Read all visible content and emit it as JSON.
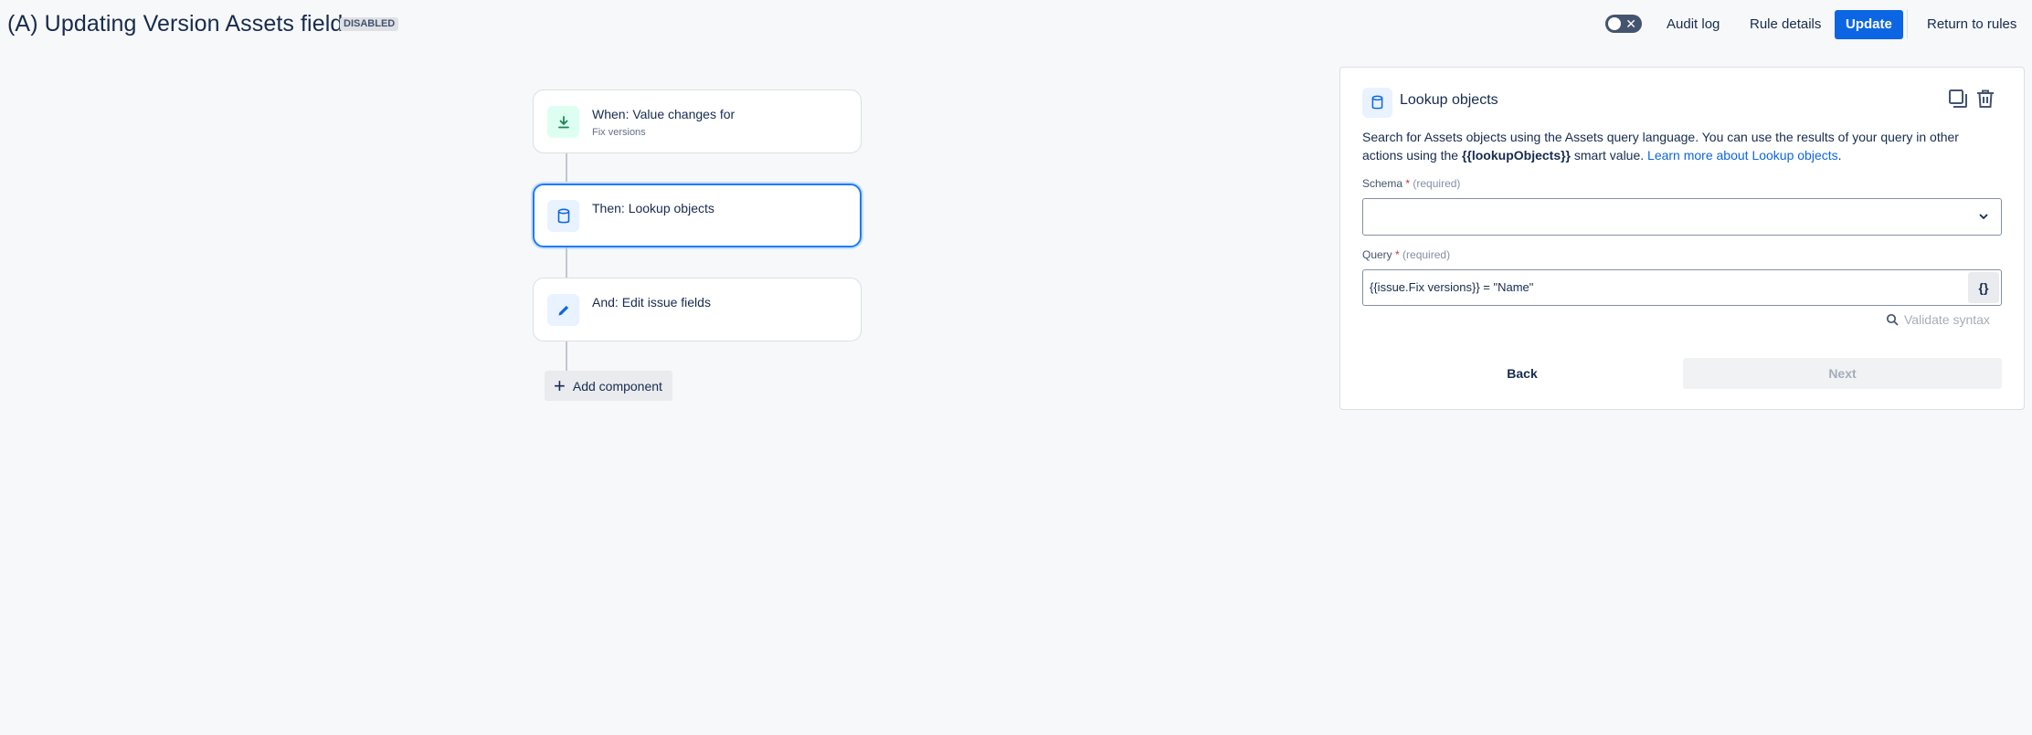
{
  "header": {
    "title": "(A) Updating Version Assets field",
    "status_badge": "DISABLED",
    "toggle_icon": "✕",
    "audit_log": "Audit log",
    "rule_details": "Rule details",
    "update": "Update",
    "return_to_rules": "Return to rules"
  },
  "flow": {
    "trigger": {
      "label": "When: Value changes for",
      "sublabel": "Fix versions",
      "icon": "download-arrow-icon"
    },
    "action1": {
      "label": "Then: Lookup objects",
      "icon": "cylinder-icon"
    },
    "action2": {
      "label": "And: Edit issue fields",
      "icon": "pencil-icon"
    },
    "add_component": "Add component"
  },
  "panel": {
    "title": "Lookup objects",
    "desc_prefix": "Search for Assets objects using the Assets query language. You can use the results of your query in other actions using the ",
    "desc_smart": "{{lookupObjects}}",
    "desc_middle": " smart value. ",
    "desc_link": "Learn more about Lookup objects",
    "desc_suffix": ".",
    "schema_label": "Schema",
    "required_star": "*",
    "required_text": "(required)",
    "schema_value": "",
    "query_label": "Query",
    "query_value": "{{issue.Fix versions}} = \"Name\"",
    "braces": "{}",
    "validate": "Validate syntax",
    "back": "Back",
    "next": "Next"
  },
  "colors": {
    "primary": "#0c66e4",
    "selected_border": "#1d7afc",
    "trigger_icon_bg": "#dcfff1",
    "action_icon_bg": "#e9f2ff"
  }
}
